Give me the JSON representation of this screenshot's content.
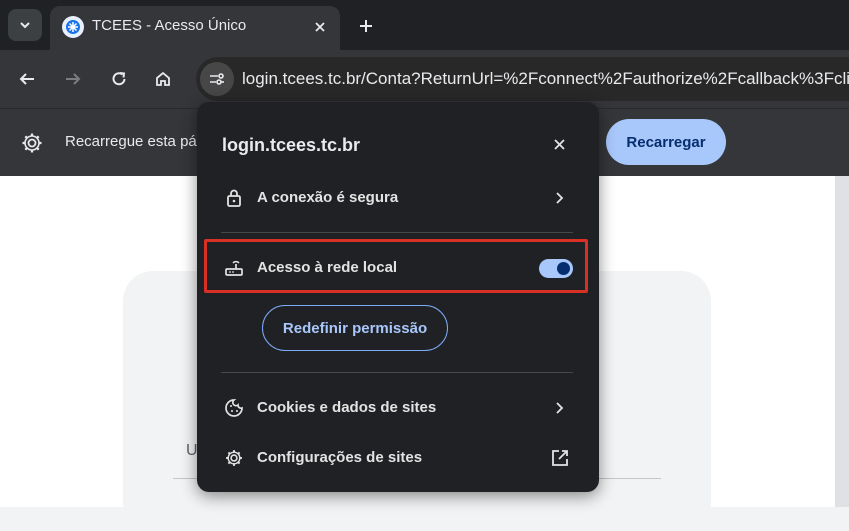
{
  "tabs": [
    {
      "title": "TCEES - Acesso Único",
      "active": true
    }
  ],
  "toolbar": {
    "url": "login.tcees.tc.br/Conta?ReturnUrl=%2Fconnect%2Fauthorize%2Fcallback%3Fcli"
  },
  "infobar": {
    "message": "Recarregue esta pá",
    "reload_label": "Recarregar"
  },
  "page": {
    "username_initial": "U"
  },
  "popup": {
    "domain": "login.tcees.tc.br",
    "connection_label": "A conexão é segura",
    "local_network_label": "Acesso à rede local",
    "local_network_enabled": true,
    "reset_permission_label": "Redefinir permissão",
    "cookies_label": "Cookies e dados de sites",
    "site_settings_label": "Configurações de sites"
  },
  "colors": {
    "accent": "#a8c7fa",
    "highlight": "#d93025",
    "popup_bg": "#202124"
  },
  "icons": [
    "tab-list-icon",
    "tcees-favicon-icon",
    "close-icon",
    "plus-icon",
    "back-arrow-icon",
    "forward-arrow-icon",
    "reload-icon",
    "home-icon",
    "site-info-icon",
    "gear-icon",
    "lock-icon",
    "chevron-right-icon",
    "router-icon",
    "cookie-icon",
    "external-link-icon"
  ]
}
